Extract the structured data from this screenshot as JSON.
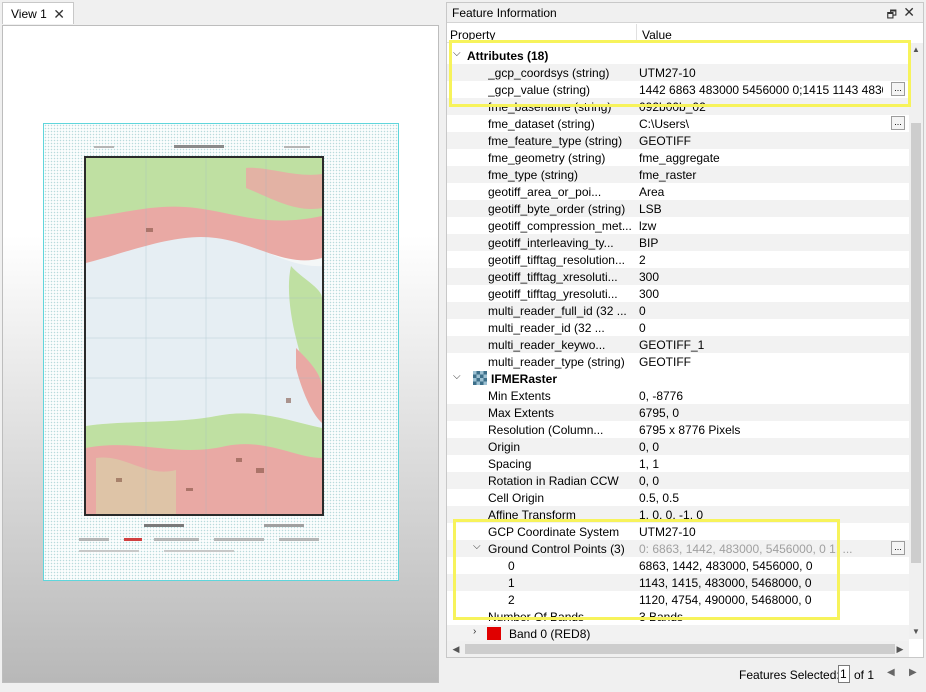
{
  "view_tab": {
    "label": "View 1",
    "close": "✕"
  },
  "panel": {
    "title": "Feature Information",
    "float_icon": "restore-icon",
    "close": "✕",
    "columns": {
      "property": "Property",
      "value": "Value"
    }
  },
  "attributes": {
    "group_label": "Attributes (18)",
    "rows": [
      {
        "name": "_gcp_coordsys (string)",
        "value": "UTM27-10"
      },
      {
        "name": "_gcp_value (string)",
        "value": "1442 6863 483000 5456000 0;1415 1143 4830...",
        "more": true
      },
      {
        "name": "fme_basename (string)",
        "value": "092b00b_02"
      },
      {
        "name": "fme_dataset (string)",
        "value": "C:\\Users\\",
        "more": true
      },
      {
        "name": "fme_feature_type (string)",
        "value": "GEOTIFF"
      },
      {
        "name": "fme_geometry (string)",
        "value": "fme_aggregate"
      },
      {
        "name": "fme_type (string)",
        "value": "fme_raster"
      },
      {
        "name": "geotiff_area_or_poi...",
        "value": "Area"
      },
      {
        "name": "geotiff_byte_order (string)",
        "value": "LSB"
      },
      {
        "name": "geotiff_compression_met...",
        "value": "lzw"
      },
      {
        "name": "geotiff_interleaving_ty...",
        "value": "BIP"
      },
      {
        "name": "geotiff_tifftag_resolution...",
        "value": "2"
      },
      {
        "name": "geotiff_tifftag_xresoluti...",
        "value": "300"
      },
      {
        "name": "geotiff_tifftag_yresoluti...",
        "value": "300"
      },
      {
        "name": "multi_reader_full_id (32 ...",
        "value": "0"
      },
      {
        "name": "multi_reader_id (32 ...",
        "value": "0"
      },
      {
        "name": "multi_reader_keywo...",
        "value": "GEOTIFF_1"
      },
      {
        "name": "multi_reader_type (string)",
        "value": "GEOTIFF"
      }
    ]
  },
  "raster": {
    "group_label": "IFMERaster",
    "icon": "raster-icon",
    "rows": [
      {
        "name": "Min Extents",
        "value": "0, -8776"
      },
      {
        "name": "Max Extents",
        "value": "6795, 0"
      },
      {
        "name": "Resolution (Column...",
        "value": "6795 x 8776 Pixels"
      },
      {
        "name": "Origin",
        "value": "0, 0"
      },
      {
        "name": "Spacing",
        "value": "1, 1"
      },
      {
        "name": "Rotation in Radian CCW",
        "value": "0, 0"
      },
      {
        "name": "Cell Origin",
        "value": "0.5, 0.5"
      },
      {
        "name": "Affine Transform",
        "value": "1, 0, 0, -1, 0"
      },
      {
        "name": "GCP Coordinate System",
        "value": "UTM27-10"
      }
    ],
    "gcp": {
      "label": "Ground Control Points (3)",
      "summary": "0: 6863, 1442, 483000, 5456000, 0 1: ...",
      "points": [
        {
          "index": "0",
          "value": "6863, 1442, 483000, 5456000, 0"
        },
        {
          "index": "1",
          "value": "1143, 1415, 483000, 5468000, 0"
        },
        {
          "index": "2",
          "value": "1120, 4754, 490000, 5468000, 0"
        }
      ]
    },
    "bands_row": {
      "name": "Number Of Bands",
      "value": "3 Bands"
    },
    "band0": {
      "label": "Band 0 (RED8)",
      "color": "#e00000"
    }
  },
  "status": {
    "features_selected_label": "Features Selected:",
    "current": "1",
    "of_label": "of 1"
  },
  "colors": {
    "highlight": "#f7f35b",
    "map_border": "#5fd6dc"
  }
}
